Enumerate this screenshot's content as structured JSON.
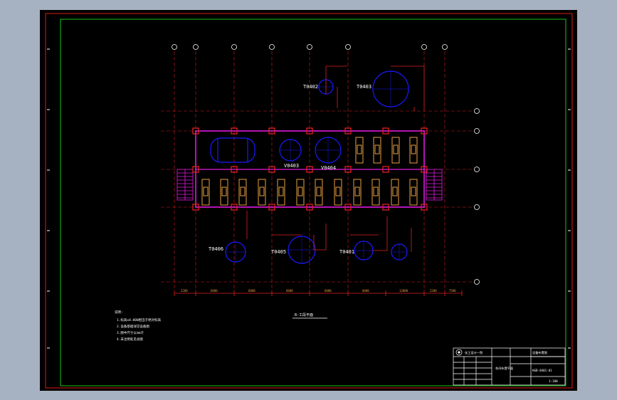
{
  "colors": {
    "outer_frame": "#e01818",
    "inner_frame": "#17c417",
    "grid_line": "#d81c1c",
    "wall": "#e01ae0",
    "column": "#e02020",
    "vessel": "#1a1aff",
    "equipment": "#e8a040",
    "stairs": "#e01ae0",
    "text": "#ffffff",
    "dimension": "#e02020"
  },
  "icons": {
    "stair": "stair-hatch-icon",
    "pump": "pump-symbol-icon",
    "company_logo": "company-logo-icon"
  },
  "tank_labels": [
    "T0402",
    "T0403",
    "V0403",
    "V0404",
    "T0406",
    "T0405",
    "T0401"
  ],
  "dimension_labels": [
    "2200",
    "6000",
    "6000",
    "6000",
    "6000",
    "6000",
    "12000",
    "2200",
    "7500"
  ],
  "plan_title": "B-工段平面",
  "notes": {
    "title": "说明:",
    "lines": [
      "1.标高±0.000相当于绝对标高",
      "2.设备基础详见设备图",
      "3.图中尺寸以mm计",
      "4.未注明处见总图"
    ]
  },
  "title_block": {
    "company": "化工设计一院",
    "drawing_title": "设备布置图",
    "sheet_label": "车间布置平面",
    "drawing_no": "HGB-0401-01",
    "scale": "1:100"
  }
}
